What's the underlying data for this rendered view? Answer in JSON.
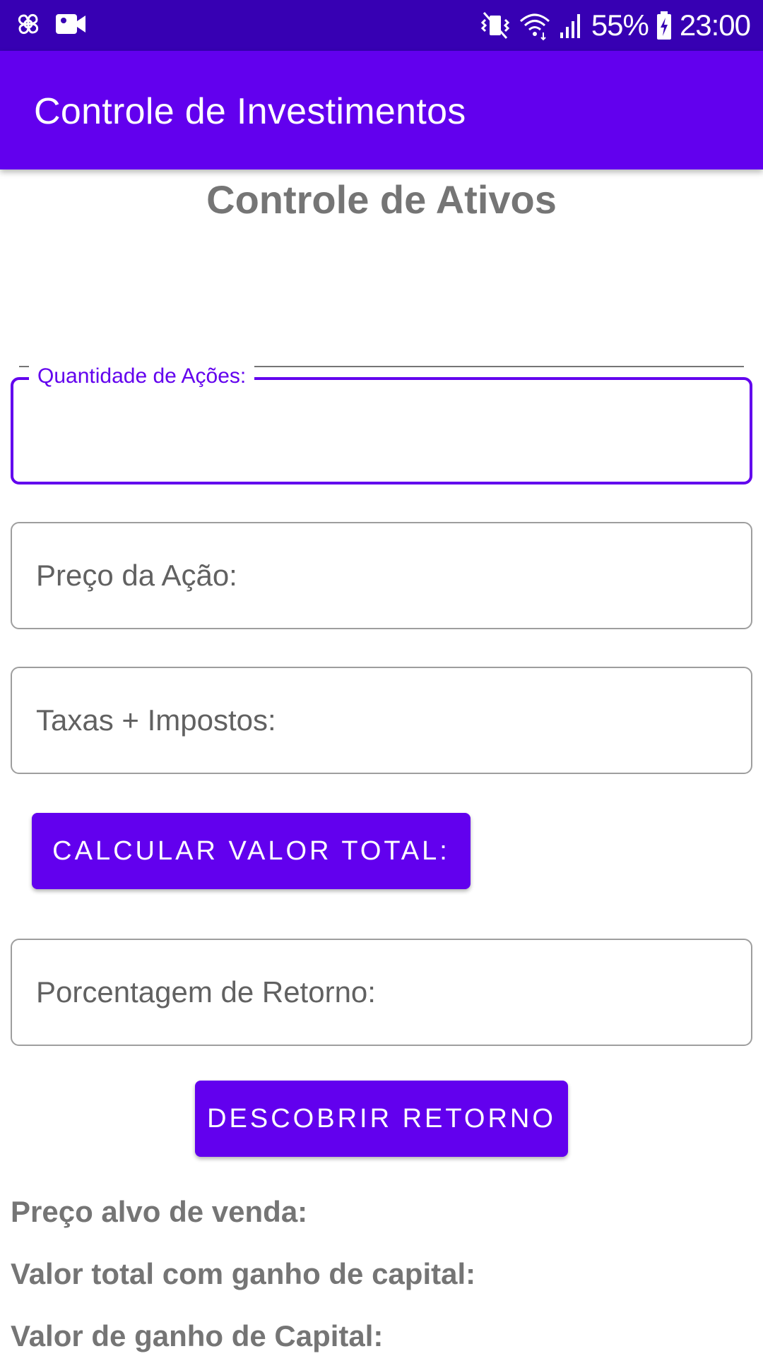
{
  "status_bar": {
    "left_icons": [
      "pinwheel-icon",
      "video-camera-icon"
    ],
    "right_icons": [
      "vibrate-mute-icon",
      "wifi-icon",
      "signal-icon",
      "battery-charging-icon"
    ],
    "battery": "55%",
    "time": "23:00"
  },
  "app_bar": {
    "title": "Controle de Investimentos"
  },
  "main": {
    "section_title": "Controle de Ativos",
    "fields": {
      "quantidade_label": "Quantidade de Ações:",
      "preco_placeholder": "Preço da Ação:",
      "taxas_placeholder": "Taxas + Impostos:",
      "porcentagem_placeholder": "Porcentagem de Retorno:"
    },
    "buttons": {
      "calcular": "CALCULAR VALOR TOTAL:",
      "descobrir": "DESCOBRIR RETORNO"
    },
    "results": {
      "preco_alvo": "Preço alvo de venda:",
      "valor_total": "Valor total com ganho de capital:",
      "valor_ganho": "Valor de ganho de Capital:"
    }
  },
  "colors": {
    "primary": "#6200ee",
    "primary_dark": "#3700b3",
    "text_gray": "#757575"
  }
}
